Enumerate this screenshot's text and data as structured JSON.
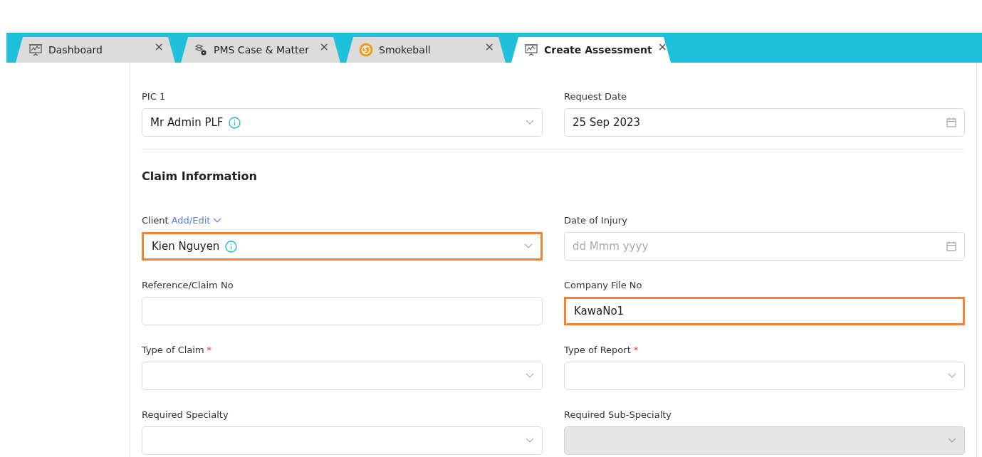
{
  "tabs": [
    {
      "label": "Dashboard",
      "kind": "presentation",
      "selected": false
    },
    {
      "label": "PMS Case & Matter",
      "kind": "gears",
      "selected": false
    },
    {
      "label": "Smokeball",
      "kind": "brand",
      "selected": false
    },
    {
      "label": "Create Assessment",
      "kind": "presentation",
      "selected": true
    }
  ],
  "tab_close": "×",
  "top_fields": [
    {
      "label": "PIC 1",
      "kind": "select",
      "value": "Mr Admin PLF",
      "info": true,
      "highlighted": false,
      "disabled": false
    },
    {
      "label": "Request Date",
      "kind": "date",
      "value": "25 Sep 2023",
      "highlighted": false,
      "disabled": false
    }
  ],
  "section": {
    "title": "Claim Information"
  },
  "fields": [
    {
      "label": "Client",
      "link": "Add/Edit",
      "kind": "select",
      "value": "Kien Nguyen",
      "info": true,
      "highlighted": true,
      "disabled": false
    },
    {
      "label": "Date of Injury",
      "kind": "date",
      "placeholder": "dd Mmm yyyy",
      "highlighted": false,
      "disabled": false
    },
    {
      "label": "Reference/Claim No",
      "kind": "text",
      "highlighted": false,
      "disabled": false
    },
    {
      "label": "Company File No",
      "kind": "text",
      "value": "KawaNo1",
      "highlighted": true,
      "disabled": false
    },
    {
      "label": "Type of Claim",
      "required_mark": "*",
      "kind": "select",
      "highlighted": false,
      "disabled": false
    },
    {
      "label": "Type of Report",
      "required_mark": "*",
      "kind": "select",
      "highlighted": false,
      "disabled": false
    },
    {
      "label": "Required Specialty",
      "kind": "select",
      "highlighted": false,
      "disabled": false
    },
    {
      "label": "Required Sub-Specialty",
      "kind": "select",
      "highlighted": false,
      "disabled": true
    }
  ]
}
